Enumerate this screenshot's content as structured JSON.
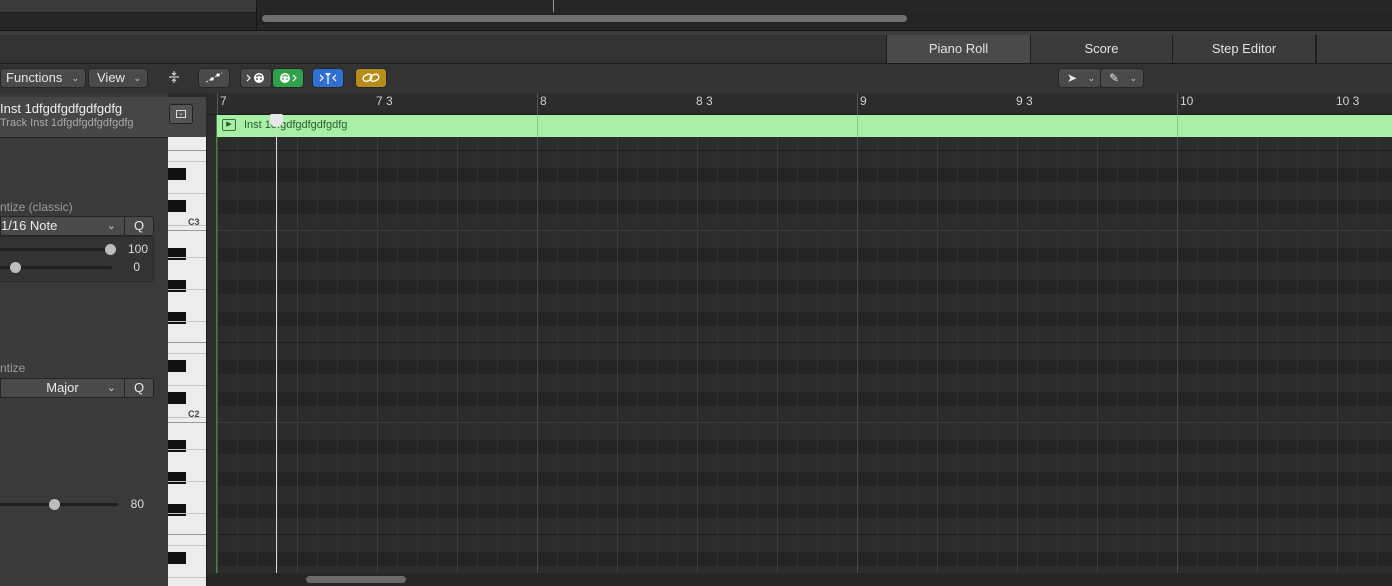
{
  "tabs": [
    {
      "label": "Piano Roll",
      "active": true
    },
    {
      "label": "Score",
      "active": false
    },
    {
      "label": "Step Editor",
      "active": false
    }
  ],
  "toolbar": {
    "functions_label": "Functions",
    "view_label": "View"
  },
  "inspector": {
    "track_name": "Inst 1dfgdfgdfgdfgdfg",
    "track_subtitle": "Track Inst 1dfgdfgdfgdfgdfg",
    "time_quantize": {
      "label": "ntize (classic)",
      "value": "1/16 Note",
      "q_label": "Q",
      "strength_value": "100",
      "swing_value": "0"
    },
    "scale_quantize": {
      "label": "ntize",
      "value": "Major",
      "q_label": "Q"
    },
    "velocity_value": "80"
  },
  "ruler": {
    "bars": [
      "7",
      "7 3",
      "8",
      "8 3",
      "9",
      "9 3",
      "10",
      "10 3"
    ]
  },
  "region": {
    "name": "Inst 1dfgdfgdfgdfgdfg"
  },
  "keyboard": {
    "labels": [
      "C3",
      "C2"
    ]
  },
  "colors": {
    "region_fill": "#a8f0a8",
    "midi_out_active": "#2fa14c",
    "catch_active": "#2f6fd0",
    "link_active": "#b58d1a"
  }
}
